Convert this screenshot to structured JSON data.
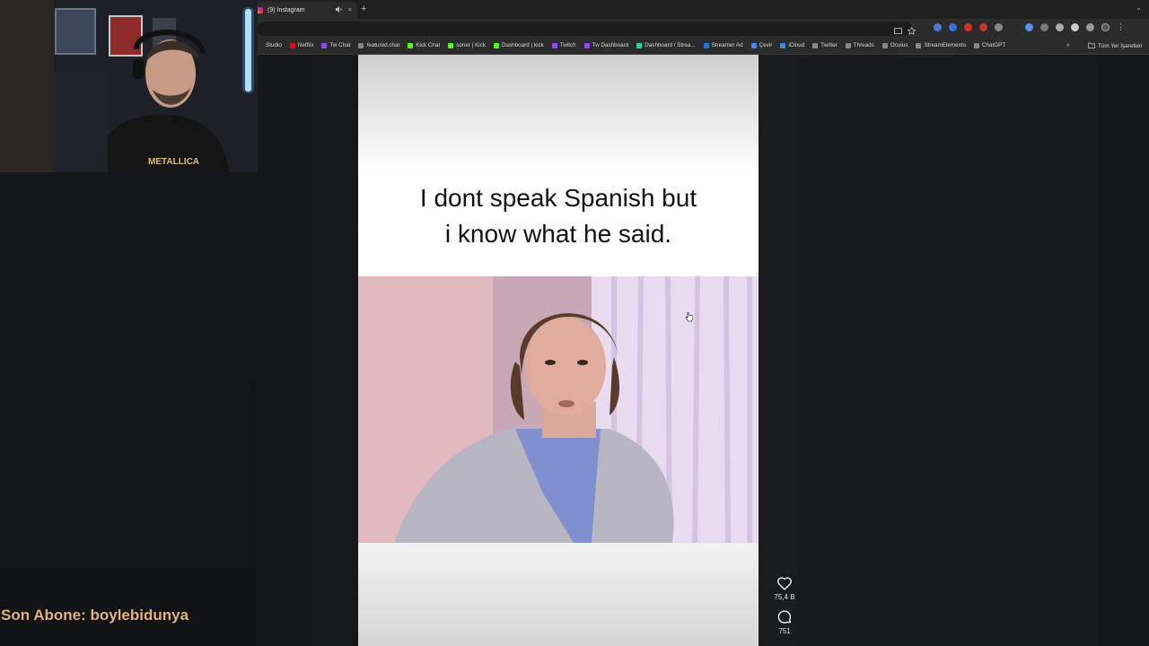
{
  "browser": {
    "tab_title": "(9) Instagram",
    "tab_mute_icon": "speaker-icon",
    "tab_close": "×",
    "new_tab": "+",
    "bookmarks": [
      {
        "label": "Studio",
        "color": "#2b2b2b"
      },
      {
        "label": "Netflix",
        "color": "#e50914"
      },
      {
        "label": "Tw Chat",
        "color": "#9146ff"
      },
      {
        "label": "featured.chat",
        "color": "#888888"
      },
      {
        "label": "Kick Chat",
        "color": "#53fc18"
      },
      {
        "label": "soner | Kick",
        "color": "#53fc18"
      },
      {
        "label": "Dashboard | kick",
        "color": "#53fc18"
      },
      {
        "label": "Twitch",
        "color": "#9146ff"
      },
      {
        "label": "Tw Dashboard",
        "color": "#9146ff"
      },
      {
        "label": "Dashboard / Strea...",
        "color": "#2bd4a4"
      },
      {
        "label": "Streamer Ad",
        "color": "#1a73e8"
      },
      {
        "label": "Çevir",
        "color": "#4285f4"
      },
      {
        "label": "iCloud",
        "color": "#3a8dde"
      },
      {
        "label": "Twitter",
        "color": "#888888"
      },
      {
        "label": "Threads",
        "color": "#888888"
      },
      {
        "label": "Oculus",
        "color": "#888888"
      },
      {
        "label": "StreamElements",
        "color": "#888888"
      },
      {
        "label": "ChatGPT",
        "color": "#888888"
      }
    ],
    "bookmarks_more": "»",
    "all_bookmarks": "Tüm Yer İşaretleri"
  },
  "reel": {
    "caption_line1": "I dont speak Spanish but",
    "caption_line2": "i know what he said."
  },
  "actions": {
    "likes": "75,4 B",
    "comments": "751"
  },
  "overlay": {
    "subscriber_banner": "Son Abone: boylebidunya"
  },
  "colors": {
    "accent_banner": "#e7b66d",
    "chrome_bg": "#2b2b2b"
  }
}
